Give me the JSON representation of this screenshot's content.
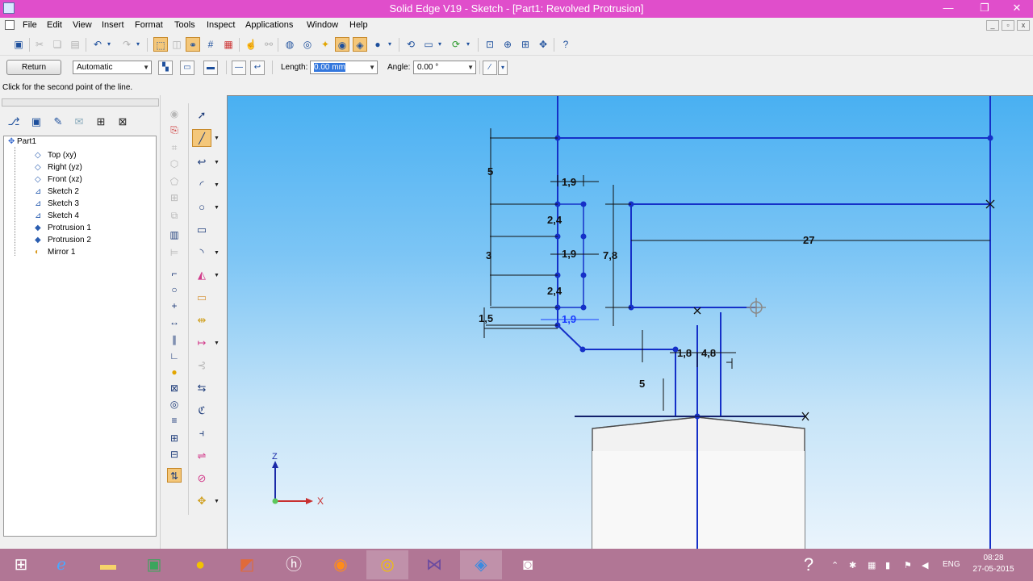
{
  "window": {
    "title": "Solid Edge V19 - Sketch - [Part1: Revolved Protrusion]",
    "minimize_glyph": "—",
    "restore_glyph": "❐",
    "close_glyph": "✕"
  },
  "menu": {
    "items": [
      "File",
      "Edit",
      "View",
      "Insert",
      "Format",
      "Tools",
      "Inspect",
      "Applications",
      "Window",
      "Help"
    ],
    "mdi": [
      "_",
      "▫",
      "x"
    ]
  },
  "ribbon": {
    "return_label": "Return",
    "mode_value": "Automatic",
    "length_label": "Length:",
    "length_value": "0.00 mm",
    "angle_label": "Angle:",
    "angle_value": "0.00 °"
  },
  "status_prompt": "Click for the second point of the line.",
  "tree": {
    "root": "Part1",
    "items": [
      {
        "label": "Top (xy)",
        "icon": "plane-icon"
      },
      {
        "label": "Right (yz)",
        "icon": "plane-icon"
      },
      {
        "label": "Front (xz)",
        "icon": "plane-icon"
      },
      {
        "label": "Sketch 2",
        "icon": "sketch-icon"
      },
      {
        "label": "Sketch 3",
        "icon": "sketch-icon"
      },
      {
        "label": "Sketch 4",
        "icon": "sketch-icon"
      },
      {
        "label": "Protrusion 1",
        "icon": "protrusion-icon"
      },
      {
        "label": "Protrusion 2",
        "icon": "protrusion-icon"
      },
      {
        "label": "Mirror 1",
        "icon": "mirror-icon"
      }
    ]
  },
  "dimensions": {
    "d_5_top": "5",
    "d_1_9_a": "1,9",
    "d_2_4_a": "2,4",
    "d_3": "3",
    "d_1_9_b": "1,9",
    "d_7_8": "7,8",
    "d_27": "27",
    "d_2_4_b": "2,4",
    "d_1_5": "1,5",
    "d_1_9_c": "1,9",
    "d_1_8": "1,8",
    "d_4_8": "4,8",
    "d_5_bottom": "5"
  },
  "axes": {
    "z_label": "Z",
    "x_label": "X"
  },
  "taskbar": {
    "language": "ENG",
    "time": "08:28",
    "date": "27-05-2015"
  },
  "colors": {
    "titlebar": "#e04ecb",
    "taskbar": "#b17695",
    "sketch_line": "#1530c8",
    "dimension_line": "#111111",
    "active_tool": "#f4c77a"
  }
}
